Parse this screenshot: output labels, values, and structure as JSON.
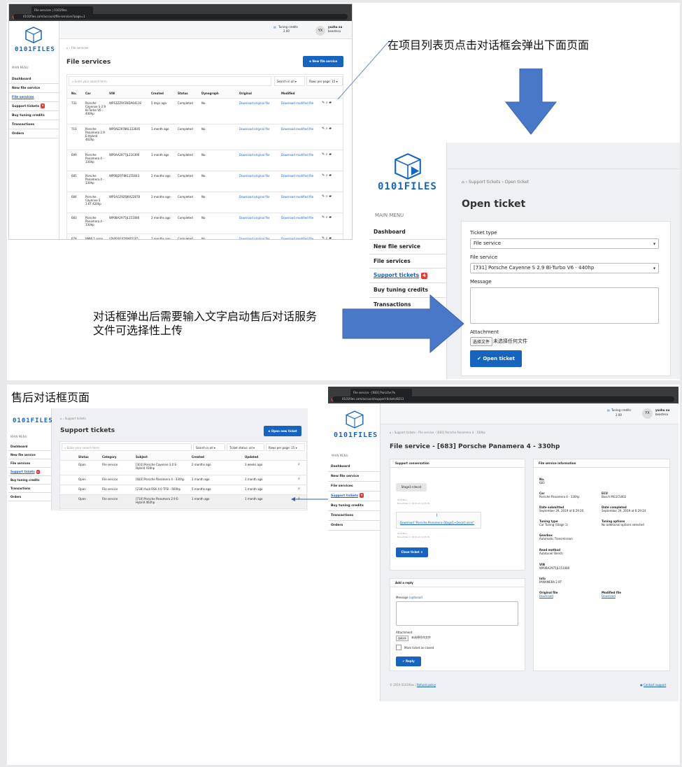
{
  "annotations": {
    "top_right": "在项目列表页点击对话框会弹出下面页面",
    "middle_left_line1": "对话框弹出后需要输入文字启动售后对话服务",
    "middle_left_line2": "文件可选择性上传",
    "bottom_left": "售后对话框页面"
  },
  "colors": {
    "accent": "#1565c0",
    "badge": "#e53935",
    "arrow": "#4a78c8"
  },
  "sc1": {
    "tab_title": "File services | 0101files",
    "url": "0101files.com/account/file-services?page=1",
    "tuning_credits_label": "Tuning credits",
    "tuning_credits_value": "2.00",
    "avatar": "YX",
    "user_name": "yuzhu xu",
    "user_company": "beastecu",
    "logo": "0101FILES",
    "main_menu": "MAIN MENU",
    "menu": [
      {
        "label": "Dashboard",
        "badge": ""
      },
      {
        "label": "New file service",
        "badge": ""
      },
      {
        "label": "File services",
        "badge": ""
      },
      {
        "label": "Support tickets",
        "badge": "4"
      },
      {
        "label": "Buy tuning credits",
        "badge": ""
      },
      {
        "label": "Transactions",
        "badge": ""
      },
      {
        "label": "Orders",
        "badge": ""
      }
    ],
    "breadcrumb": "File services",
    "title": "File services",
    "new_button": "New file service",
    "search_placeholder": "Enter your search term",
    "search_in": "Search in all",
    "rows_per_page": "Rows per page: 15",
    "columns": [
      "No.",
      "Car",
      "VIN",
      "Created",
      "Status",
      "Dynograph",
      "Original",
      "Modified"
    ],
    "rows": [
      {
        "no": "731",
        "car": "Porsche Cayenne S 2.9 Bi-Turbo V6 - 440hp",
        "vin": "WP1ZZZ9YZKDA64119",
        "created": "5 days ago",
        "status": "Completed",
        "dyno": "No",
        "orig": "Download original file",
        "mod": "Download modified file"
      },
      {
        "no": "710",
        "car": "Porsche Panamera 2.9 E-Hybrid 462hp",
        "vin": "WP0AE2978KL123645",
        "created": "1 month ago",
        "status": "Completed",
        "dyno": "No",
        "orig": "Download original file",
        "mod": "Download modified file"
      },
      {
        "no": "699",
        "car": "Porsche Panamera 4 - 330hp",
        "vin": "WP0AA2977JL116390",
        "created": "1 month ago",
        "status": "Completed",
        "dyno": "No",
        "orig": "Download original file",
        "mod": "Download modified file"
      },
      {
        "no": "685",
        "car": "Porsche Panamera 4 - 330hp",
        "vin": "WP0BJ2978KL155643",
        "created": "2 months ago",
        "status": "Completed",
        "dyno": "No",
        "orig": "Download original file",
        "mod": "Download modified file"
      },
      {
        "no": "684",
        "car": "Porsche Cayenne S 3.6T 420hp",
        "vin": "WP1AG2926JKA22878",
        "created": "2 months ago",
        "status": "Completed",
        "dyno": "No",
        "orig": "Download original file",
        "mod": "Download modified file"
      },
      {
        "no": "683",
        "car": "Porsche Panamera 4 - 330hp",
        "vin": "WP0BA2975JL151080",
        "created": "2 months ago",
        "status": "Completed",
        "dyno": "No",
        "orig": "Download original file",
        "mod": "Download modified file"
      },
      {
        "no": "678",
        "car": "BMW 5 serie 530i - 252hp",
        "vin": "LBVKY9107JSK85165",
        "created": "2 months ago",
        "status": "Completed",
        "dyno": "No",
        "orig": "Download original file",
        "mod": "Download modified file"
      }
    ]
  },
  "sc2": {
    "logo": "0101FILES",
    "main_menu": "MAIN MENU",
    "menu": [
      {
        "label": "Dashboard",
        "badge": ""
      },
      {
        "label": "New file service",
        "badge": ""
      },
      {
        "label": "File services",
        "badge": ""
      },
      {
        "label": "Support tickets",
        "badge": "4"
      },
      {
        "label": "Buy tuning credits",
        "badge": ""
      },
      {
        "label": "Transactions",
        "badge": ""
      }
    ],
    "breadcrumb_1": "Support tickets",
    "breadcrumb_2": "Open ticket",
    "title": "Open ticket",
    "ticket_type_label": "Ticket type",
    "ticket_type_value": "File service",
    "file_service_label": "File service",
    "file_service_value": "[731] Porsche Cayenne S 2.9 Bi-Turbo V6 - 440hp",
    "message_label": "Message",
    "attachment_label": "Attachment",
    "choose_file_btn": "选择文件",
    "no_file": "未选择任何文件",
    "submit": "Open ticket"
  },
  "sc3": {
    "logo": "0101FILES",
    "main_menu": "MAIN MENU",
    "menu": [
      {
        "label": "Dashboard",
        "badge": ""
      },
      {
        "label": "New file service",
        "badge": ""
      },
      {
        "label": "File services",
        "badge": ""
      },
      {
        "label": "Support tickets",
        "badge": "4"
      },
      {
        "label": "Buy tuning credits",
        "badge": ""
      },
      {
        "label": "Transactions",
        "badge": ""
      },
      {
        "label": "Orders",
        "badge": ""
      }
    ],
    "breadcrumb": "Support tickets",
    "title": "Support tickets",
    "new_button": "Open new ticket",
    "search_placeholder": "Enter your search term",
    "search_in": "Search in all",
    "status_filter": "Ticket status: all",
    "rows_per_page": "Rows per page: 15",
    "columns": [
      "Status",
      "Category",
      "Subject",
      "Created",
      "Updated"
    ],
    "rows": [
      {
        "status": "Open",
        "category": "File service",
        "subject": "[303] Porsche Cayenne 3.0 E-Hybrid 416hp",
        "created": "2 months ago",
        "updated": "3 weeks ago"
      },
      {
        "status": "Open",
        "category": "File service",
        "subject": "[683] Porsche Panamera 4 - 330hp",
        "created": "1 month ago",
        "updated": "1 month ago"
      },
      {
        "status": "Open",
        "category": "File service",
        "subject": "[238] Audi RS6 4.0 TFSI - 560hp",
        "created": "5 months ago",
        "updated": "1 month ago"
      },
      {
        "status": "Open",
        "category": "File service",
        "subject": "[710] Porsche Panamera 2.9 E-Hybrid 462hp",
        "created": "1 month ago",
        "updated": "1 month ago"
      }
    ]
  },
  "sc4": {
    "tab_title": "File service - [683] Porsche Pa",
    "url": "0101files.com/account/support-tickets/8213",
    "tuning_credits_label": "Tuning credits",
    "tuning_credits_value": "2.00",
    "avatar": "YX",
    "user_name": "yuzhu xu",
    "user_company": "beastecu",
    "logo": "0101FILES",
    "main_menu": "MAIN MENU",
    "menu": [
      {
        "label": "Dashboard",
        "badge": ""
      },
      {
        "label": "New file service",
        "badge": ""
      },
      {
        "label": "File services",
        "badge": ""
      },
      {
        "label": "Support tickets",
        "badge": "4"
      },
      {
        "label": "Buy tuning credits",
        "badge": ""
      },
      {
        "label": "Transactions",
        "badge": ""
      },
      {
        "label": "Orders",
        "badge": ""
      }
    ],
    "breadcrumb_1": "Support tickets",
    "breadcrumb_2": "File service - [683] Porsche Panamera 4 - 330hp",
    "title": "File service - [683] Porsche Panamera 4 - 330hp",
    "conv_header": "Support conversation",
    "msg1": "Stage1+decat",
    "msg1_meta1": "0101files",
    "msg1_meta2": "November 2, 2019 at 10:25:30",
    "download_link": "Download \"Porsche Panamera (Stage1+Decat).xlsm\"",
    "msg2_meta1": "0101files",
    "msg2_meta2": "November 2, 2019 at 10:25:30",
    "close_ticket": "Close ticket",
    "reply_header": "Add a reply",
    "message_label": "Message",
    "message_optional": "(optional)",
    "attachment_label": "Attachment",
    "choose_file_btn": "选择文件",
    "no_file": "未选择任何文件",
    "mark_closed": "Mark ticket as closed",
    "reply_button": "Reply",
    "info_header": "File service information",
    "info": {
      "no_label": "No.",
      "no_value": "683",
      "car_label": "Car",
      "car_value": "Porsche Panamera 4 - 330hp",
      "ecu_label": "ECU",
      "ecu_value": "Bosch MG1CS002",
      "submitted_label": "Date submitted",
      "submitted_value": "September 29, 2019 at 6:29:20",
      "completed_label": "Date completed",
      "completed_value": "September 29, 2019 at 6:29:24",
      "tuning_type_label": "Tuning type",
      "tuning_type_value": "Car Tuning (Stage 1)",
      "tuning_options_label": "Tuning options",
      "tuning_options_value": "No additional options selected",
      "gearbox_label": "Gearbox",
      "gearbox_value": "Automatic Transmission",
      "read_method_label": "Read method",
      "read_method_value": "Autotuner Bench",
      "vin_label": "VIN",
      "vin_value": "WP0BA2975JL151080",
      "info_label": "Info",
      "info_value": "PANAMERA 2.9T",
      "orig_label": "Original file",
      "orig_value": "Download",
      "mod_label": "Modified file",
      "mod_value": "Download"
    },
    "footer_left": "© 2019 0101files |",
    "footer_refund": "Refund policy",
    "footer_contact": "Contact support"
  }
}
